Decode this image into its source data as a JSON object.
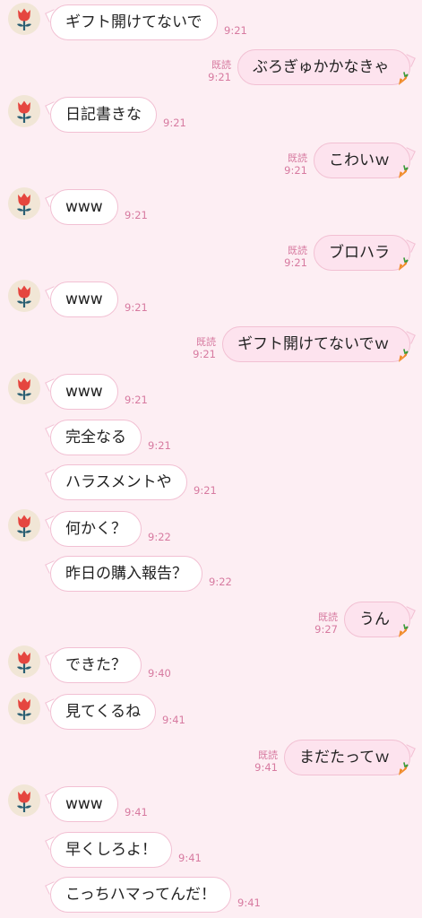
{
  "messages": [
    {
      "side": "in",
      "text": "ギフト開けてないで",
      "time": "9:21",
      "avatar": true
    },
    {
      "side": "out",
      "text": "ぶろぎゅかかなきゃ",
      "time": "9:21",
      "read": "既読"
    },
    {
      "side": "in",
      "text": "日記書きな",
      "time": "9:21",
      "avatar": true
    },
    {
      "side": "out",
      "text": "こわいｗ",
      "time": "9:21",
      "read": "既読"
    },
    {
      "side": "in",
      "text": "www",
      "time": "9:21",
      "avatar": true
    },
    {
      "side": "out",
      "text": "ブロハラ",
      "time": "9:21",
      "read": "既読"
    },
    {
      "side": "in",
      "text": "www",
      "time": "9:21",
      "avatar": true
    },
    {
      "side": "out",
      "text": "ギフト開けてないでｗ",
      "time": "9:21",
      "read": "既読"
    },
    {
      "side": "in",
      "text": "www",
      "time": "9:21",
      "avatar": true
    },
    {
      "side": "in",
      "text": "完全なる",
      "time": "9:21",
      "avatar": false
    },
    {
      "side": "in",
      "text": "ハラスメントや",
      "time": "9:21",
      "avatar": false
    },
    {
      "side": "in",
      "text": "何かく？",
      "time": "9:22",
      "avatar": true
    },
    {
      "side": "in",
      "text": "昨日の購入報告？",
      "time": "9:22",
      "avatar": false
    },
    {
      "side": "out",
      "text": "うん",
      "time": "9:27",
      "read": "既読"
    },
    {
      "side": "in",
      "text": "できた？",
      "time": "9:40",
      "avatar": true
    },
    {
      "side": "in",
      "text": "見てくるね",
      "time": "9:41",
      "avatar": true
    },
    {
      "side": "out",
      "text": "まだたってｗ",
      "time": "9:41",
      "read": "既読"
    },
    {
      "side": "in",
      "text": "www",
      "time": "9:41",
      "avatar": true
    },
    {
      "side": "in",
      "text": "早くしろよ！",
      "time": "9:41",
      "avatar": false
    },
    {
      "side": "in",
      "text": "こっちハマってんだ！",
      "time": "9:41",
      "avatar": false
    }
  ],
  "icons": {
    "avatar": "red-tulip-icon",
    "sticker": "carrot-icon"
  },
  "colors": {
    "background": "#fdeef3",
    "bubble_border": "#f2c0d3",
    "outgoing_bubble": "#fde3ee",
    "timestamp": "#d77aa0",
    "tulip": "#e5463f",
    "stem": "#2a5f73",
    "carrot": "#f08a24"
  }
}
